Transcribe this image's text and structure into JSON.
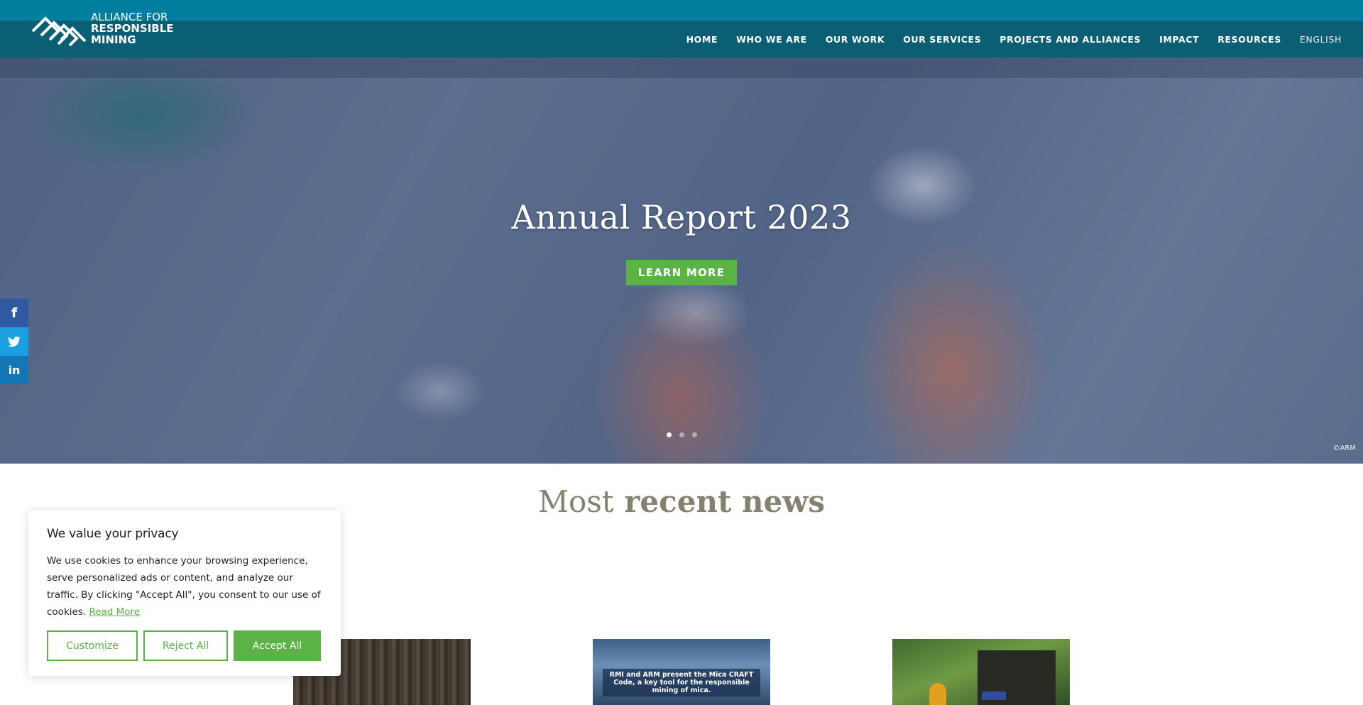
{
  "brand": {
    "line1": "ALLIANCE FOR",
    "line2": "RESPONSIBLE",
    "line3": "MINING"
  },
  "nav": {
    "items": [
      {
        "label": "HOME"
      },
      {
        "label": "WHO WE ARE"
      },
      {
        "label": "OUR WORK"
      },
      {
        "label": "OUR SERVICES"
      },
      {
        "label": "PROJECTS AND ALLIANCES"
      },
      {
        "label": "IMPACT"
      },
      {
        "label": "RESOURCES"
      }
    ],
    "language": "ENGLISH"
  },
  "hero": {
    "title": "Annual Report 2023",
    "button_label": "LEARN MORE",
    "credit": "©ARM",
    "slides_total": 3,
    "active_slide": 1
  },
  "social": {
    "facebook_glyph": "f",
    "twitter_glyph": "🐦",
    "linkedin_glyph": "in",
    "icons": [
      "facebook-icon",
      "twitter-icon",
      "linkedin-icon"
    ]
  },
  "news": {
    "heading_light": "Most",
    "heading_bold": "recent news",
    "cards": [
      {
        "caption": ""
      },
      {
        "caption": "RMI and ARM present the Mica CRAFT Code, a key tool for the responsible mining of mica."
      },
      {
        "caption": ""
      }
    ]
  },
  "cookie": {
    "title": "We value your privacy",
    "text": "We use cookies to enhance your browsing experience, serve personalized ads or content, and analyze our traffic. By clicking \"Accept All\", you consent to our use of cookies.",
    "read_more": "Read More",
    "customize": "Customize",
    "reject": "Reject All",
    "accept": "Accept All"
  },
  "colors": {
    "topbar": "#007e9e",
    "header": "#0b5f74",
    "accent_green": "#5bb346",
    "heading_text": "#84816f"
  }
}
